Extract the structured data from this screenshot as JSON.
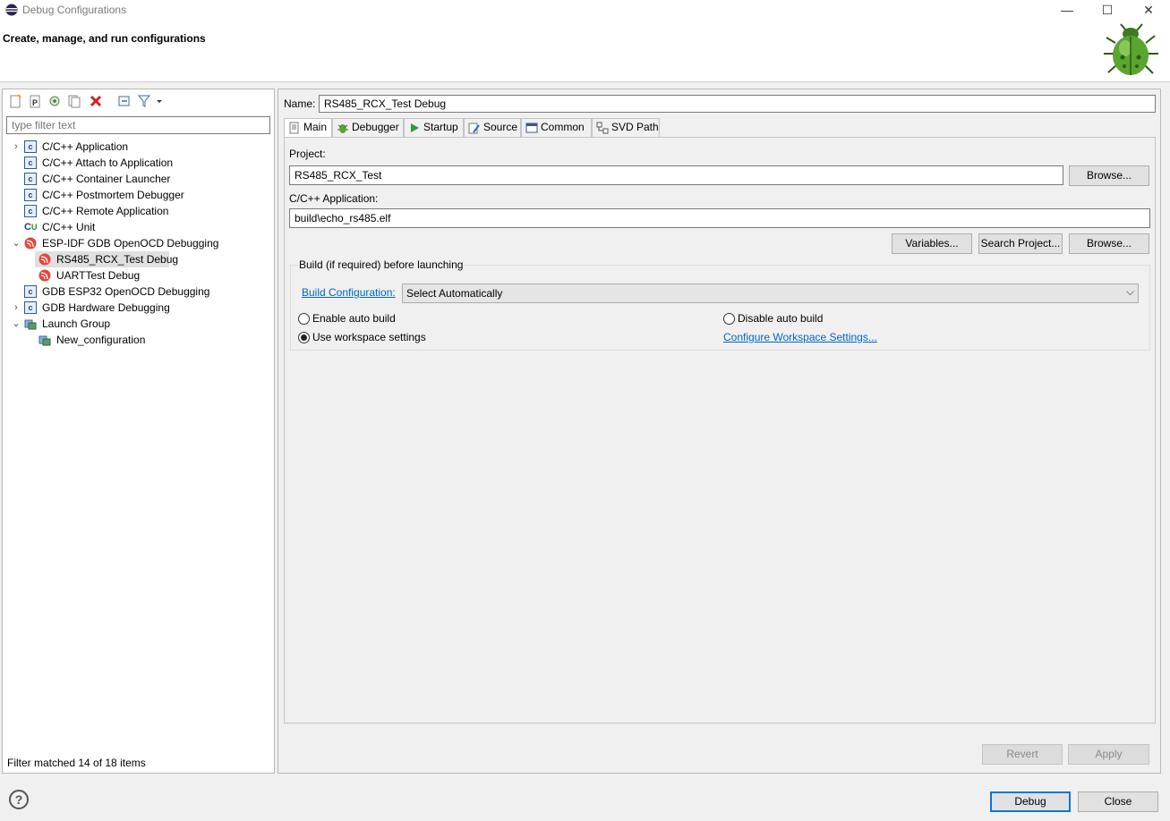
{
  "window": {
    "title": "Debug Configurations",
    "minimize": "—",
    "maximize": "☐",
    "close": "✕",
    "heading": "Create, manage, and run configurations"
  },
  "sidebar": {
    "filter_placeholder": "type filter text",
    "toolbar": [
      "new-launch-configuration-icon",
      "new-prototype-icon",
      "export-icon",
      "duplicate-icon",
      "delete-icon",
      "collapse-all-icon",
      "filter-icon",
      "dropdown-arrow-icon"
    ],
    "tree": [
      {
        "label": "C/C++ Application",
        "level": 0,
        "expandable": true,
        "expanded": false,
        "icon": "c-file-icon"
      },
      {
        "label": "C/C++ Attach to Application",
        "level": 0,
        "expandable": false,
        "icon": "c-file-icon"
      },
      {
        "label": "C/C++ Container Launcher",
        "level": 0,
        "expandable": false,
        "icon": "c-file-icon"
      },
      {
        "label": "C/C++ Postmortem Debugger",
        "level": 0,
        "expandable": false,
        "icon": "c-file-icon"
      },
      {
        "label": "C/C++ Remote Application",
        "level": 0,
        "expandable": false,
        "icon": "c-file-icon"
      },
      {
        "label": "C/C++ Unit",
        "level": 0,
        "expandable": false,
        "icon": "c-unit-icon"
      },
      {
        "label": "ESP-IDF GDB OpenOCD Debugging",
        "level": 0,
        "expandable": true,
        "expanded": true,
        "icon": "espressif-icon"
      },
      {
        "label": "RS485_RCX_Test Debug",
        "level": 1,
        "selected": true,
        "icon": "espressif-icon"
      },
      {
        "label": "UARTTest Debug",
        "level": 1,
        "icon": "espressif-icon"
      },
      {
        "label": "GDB ESP32 OpenOCD Debugging",
        "level": 0,
        "expandable": false,
        "icon": "c-file-icon"
      },
      {
        "label": "GDB Hardware Debugging",
        "level": 0,
        "expandable": true,
        "expanded": false,
        "icon": "c-file-icon"
      },
      {
        "label": "Launch Group",
        "level": 0,
        "expandable": true,
        "expanded": true,
        "icon": "launch-group-icon"
      },
      {
        "label": "New_configuration",
        "level": 1,
        "icon": "launch-group-icon"
      }
    ],
    "filter_status": "Filter matched 14 of 18 items"
  },
  "config": {
    "name_label": "Name:",
    "name_value": "RS485_RCX_Test Debug",
    "tabs": [
      {
        "label": "Main",
        "icon": "main-tab-icon",
        "active": true
      },
      {
        "label": "Debugger",
        "icon": "debugger-tab-icon"
      },
      {
        "label": "Startup",
        "icon": "startup-tab-icon"
      },
      {
        "label": "Source",
        "icon": "source-tab-icon"
      },
      {
        "label": "Common",
        "icon": "common-tab-icon"
      },
      {
        "label": "SVD Path",
        "icon": "svd-tab-icon"
      }
    ],
    "project_label": "Project:",
    "project_value": "RS485_RCX_Test",
    "browse1": "Browse...",
    "app_label": "C/C++ Application:",
    "app_value": "build\\echo_rs485.elf",
    "variables": "Variables...",
    "search_project": "Search Project...",
    "browse2": "Browse...",
    "build_group_title": "Build (if required) before launching",
    "build_config_link": "Build Configuration:",
    "build_config_value": "Select Automatically",
    "enable_auto_build": "Enable auto build",
    "disable_auto_build": "Disable auto build",
    "use_workspace": "Use workspace settings",
    "configure_workspace_link": "Configure Workspace Settings...",
    "revert": "Revert",
    "apply": "Apply"
  },
  "footer": {
    "help": "?",
    "debug": "Debug",
    "close": "Close"
  },
  "colors": {
    "accent": "#0078d7",
    "link": "#0066cc",
    "selection": "#e0e0e0"
  }
}
